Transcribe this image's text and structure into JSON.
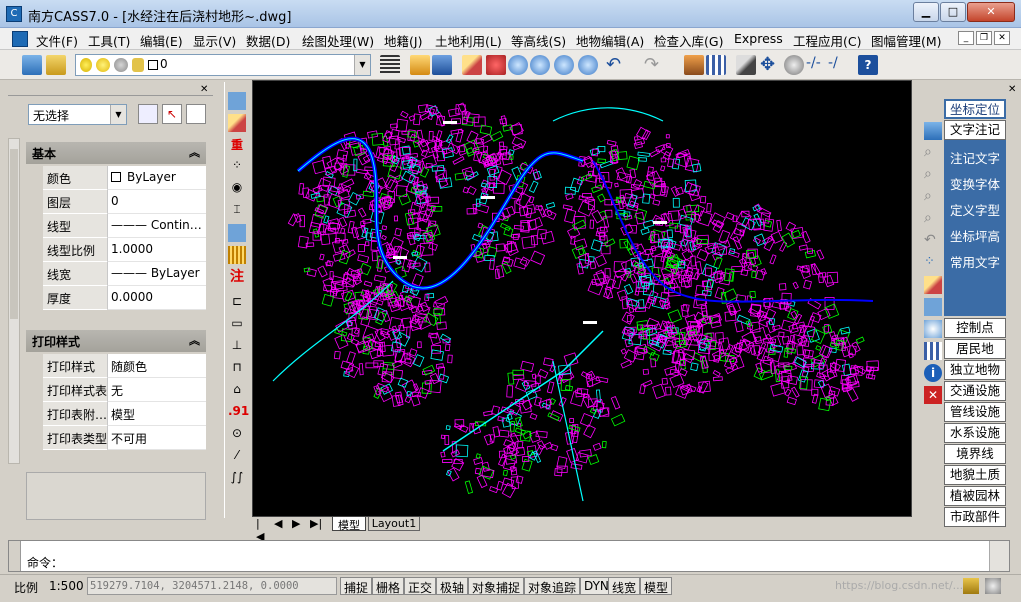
{
  "window": {
    "title": "南方CASS7.0 - [水经注在后浇村地形~.dwg]",
    "app_icon": "cass-logo-icon",
    "controls": [
      "_",
      "□",
      "×"
    ]
  },
  "menu": [
    "文件(F)",
    "工具(T)",
    "编辑(E)",
    "显示(V)",
    "数据(D)",
    "绘图处理(W)",
    "地籍(J)",
    "土地利用(L)",
    "等高线(S)",
    "地物编辑(A)",
    "检查入库(G)",
    "Express",
    "工程应用(C)",
    "图幅管理(M)"
  ],
  "toolbar": {
    "current_layer": "0"
  },
  "properties": {
    "selection": "无选择",
    "sections": {
      "basic": "基本",
      "print": "打印样式"
    },
    "basic_rows": [
      {
        "label": "颜色",
        "value": "ByLayer"
      },
      {
        "label": "图层",
        "value": "0"
      },
      {
        "label": "线型",
        "value": "——— Contin…"
      },
      {
        "label": "线型比例",
        "value": "1.0000"
      },
      {
        "label": "线宽",
        "value": "——— ByLayer"
      },
      {
        "label": "厚度",
        "value": "0.0000"
      }
    ],
    "print_rows": [
      {
        "label": "打印样式",
        "value": "随颜色"
      },
      {
        "label": "打印样式表",
        "value": "无"
      },
      {
        "label": "打印表附…",
        "value": "模型"
      },
      {
        "label": "打印表类型",
        "value": "不可用"
      }
    ]
  },
  "left_vertical_toolbar": [
    "重",
    "注",
    ".91"
  ],
  "drawing_tabs": [
    "模型",
    "Layout1"
  ],
  "right_panel": {
    "top_buttons": [
      "坐标定位",
      "文字注记"
    ],
    "blue_group": [
      "注记文字",
      "变换字体",
      "定义字型",
      "坐标坪高",
      "常用文字"
    ],
    "bottom_buttons": [
      "控制点",
      "居民地",
      "独立地物",
      "交通设施",
      "管线设施",
      "水系设施",
      "境界线",
      "地貌土质",
      "植被园林",
      "市政部件"
    ]
  },
  "command": {
    "prompt": "命令："
  },
  "status": {
    "scale_label": "比例",
    "scale_value": "1:500",
    "coordinates": "519279.7104,  3204571.2148,  0.0000",
    "toggles": [
      "捕捉",
      "栅格",
      "正交",
      "极轴",
      "对象捕捉",
      "对象追踪",
      "DYN",
      "线宽",
      "模型"
    ],
    "watermark": "https://blog.csdn.net/..."
  },
  "colors": {
    "map_background": "#000000",
    "buildings": "#ff00ff",
    "roads": "#00ffff",
    "water": "#0000ff",
    "vegetation": "#00ff00",
    "panel_blue": "#3b6ca6"
  }
}
